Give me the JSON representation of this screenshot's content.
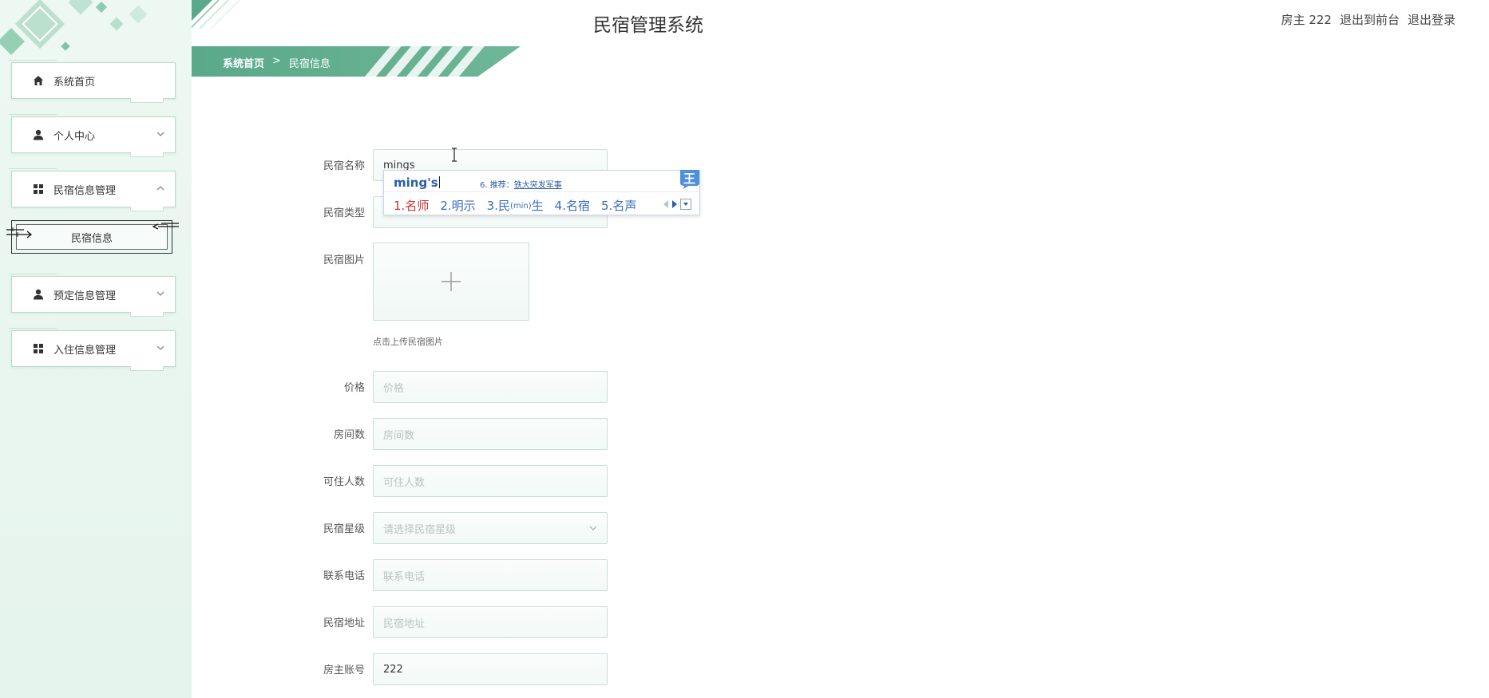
{
  "app": {
    "title": "民宿管理系统"
  },
  "header": {
    "user": "房主 222",
    "back_to_front": "退出到前台",
    "logout": "退出登录"
  },
  "breadcrumb": {
    "home": "系统首页",
    "separator": ">",
    "current": "民宿信息"
  },
  "sidebar": {
    "items": [
      {
        "label": "系统首页",
        "icon": "home-icon"
      },
      {
        "label": "个人中心",
        "icon": "user-icon"
      },
      {
        "label": "民宿信息管理",
        "icon": "grid-icon"
      },
      {
        "label": "预定信息管理",
        "icon": "user-icon"
      },
      {
        "label": "入住信息管理",
        "icon": "grid-icon"
      }
    ],
    "active_sub": "民宿信息"
  },
  "form": {
    "name": {
      "label": "民宿名称",
      "value": "mings"
    },
    "type": {
      "label": "民宿类型"
    },
    "image": {
      "label": "民宿图片",
      "hint": "点击上传民宿图片"
    },
    "price": {
      "label": "价格",
      "placeholder": "价格"
    },
    "rooms": {
      "label": "房间数",
      "placeholder": "房间数"
    },
    "capacity": {
      "label": "可住人数",
      "placeholder": "可住人数"
    },
    "star": {
      "label": "民宿星级",
      "placeholder": "请选择民宿星级"
    },
    "phone": {
      "label": "联系电话",
      "placeholder": "联系电话"
    },
    "address": {
      "label": "民宿地址",
      "placeholder": "民宿地址"
    },
    "owner": {
      "label": "房主账号",
      "value": "222"
    }
  },
  "ime": {
    "composition": "ming's",
    "recommend_label": "6. 推荐：",
    "recommend_text": "铁大突发军事",
    "candidates": [
      {
        "num": "1.",
        "text": "名师"
      },
      {
        "num": "2.",
        "text": "明示"
      },
      {
        "num": "3.",
        "text": "民",
        "sup": "(min)",
        "tail": "生"
      },
      {
        "num": "4.",
        "text": "名宿"
      },
      {
        "num": "5.",
        "text": "名声"
      }
    ],
    "badge": "王"
  },
  "colors": {
    "accent": "#5aa98a",
    "sidebar_bg": "#eef8f3",
    "field_border": "#c6e1d5",
    "ime_blue": "#3a6cc0",
    "ime_red": "#cc3333"
  }
}
